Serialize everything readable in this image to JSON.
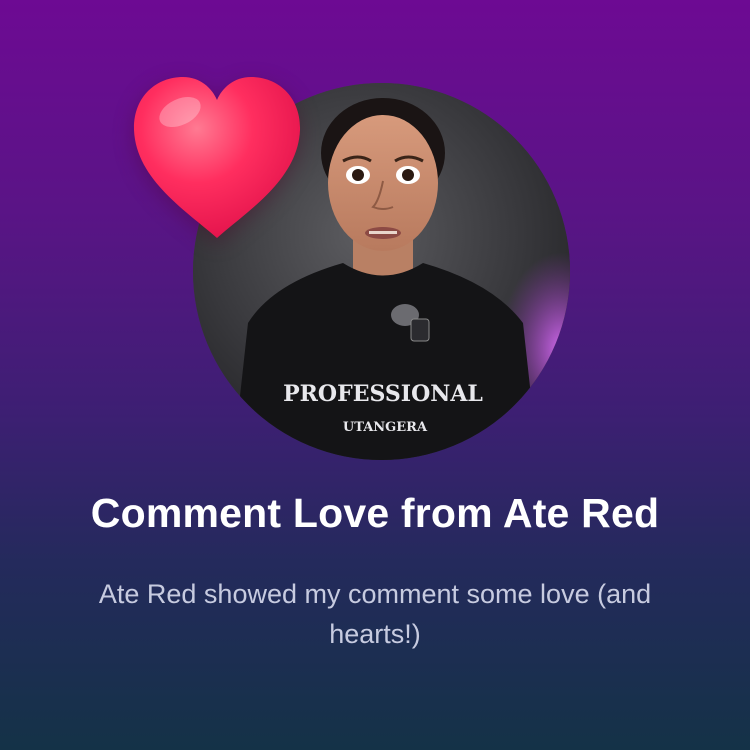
{
  "card": {
    "title": "Comment Love from Ate Red",
    "subtitle": "Ate Red showed my comment some love (and hearts!)",
    "shirt_text_main": "PROFESSIONAL",
    "shirt_text_sub": "UTANGERA"
  },
  "icons": {
    "heart": "heart-icon"
  },
  "colors": {
    "background_top": "#6d0a93",
    "background_bottom": "#143247",
    "heart": "#ff1f5a",
    "title": "#ffffff",
    "subtitle": "#c7cbe0"
  }
}
